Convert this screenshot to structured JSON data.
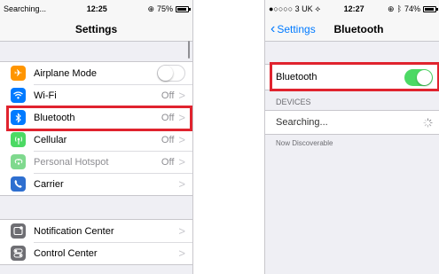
{
  "colors": {
    "highlight": "#e0232e",
    "airplane": "#ff9500",
    "wifi": "#007aff",
    "bluetooth": "#007aff",
    "cellular": "#4cd964",
    "hotspot": "#4cd964",
    "carrier": "#2e6fd0",
    "notification": "#8e8e93",
    "control": "#8e8e93",
    "toggle_on": "#4cd964"
  },
  "left": {
    "status": {
      "carrier": "Searching...",
      "time": "12:25",
      "battery": "75%",
      "battery_level": 0.75
    },
    "nav_title": "Settings",
    "rows": [
      {
        "label": "Airplane Mode",
        "icon": "airplane-icon",
        "toggle": "off"
      },
      {
        "label": "Wi-Fi",
        "value": "Off",
        "icon": "wifi-icon"
      },
      {
        "label": "Bluetooth",
        "value": "Off",
        "icon": "bluetooth-icon"
      },
      {
        "label": "Cellular",
        "value": "Off",
        "icon": "cellular-icon"
      },
      {
        "label": "Personal Hotspot",
        "value": "Off",
        "icon": "hotspot-icon"
      },
      {
        "label": "Carrier",
        "value": "",
        "icon": "carrier-icon"
      }
    ],
    "rows2": [
      {
        "label": "Notification Center",
        "icon": "notification-center-icon"
      },
      {
        "label": "Control Center",
        "icon": "control-center-icon"
      }
    ],
    "chevron": ">"
  },
  "right": {
    "status": {
      "carrier": "●○○○○ 3 UK",
      "time": "12:27",
      "battery": "74%",
      "battery_level": 0.74
    },
    "back_label": "Settings",
    "nav_title": "Bluetooth",
    "bluetooth_label": "Bluetooth",
    "bluetooth_state": "on",
    "devices_header": "DEVICES",
    "searching": "Searching...",
    "discoverable": "Now Discoverable"
  }
}
